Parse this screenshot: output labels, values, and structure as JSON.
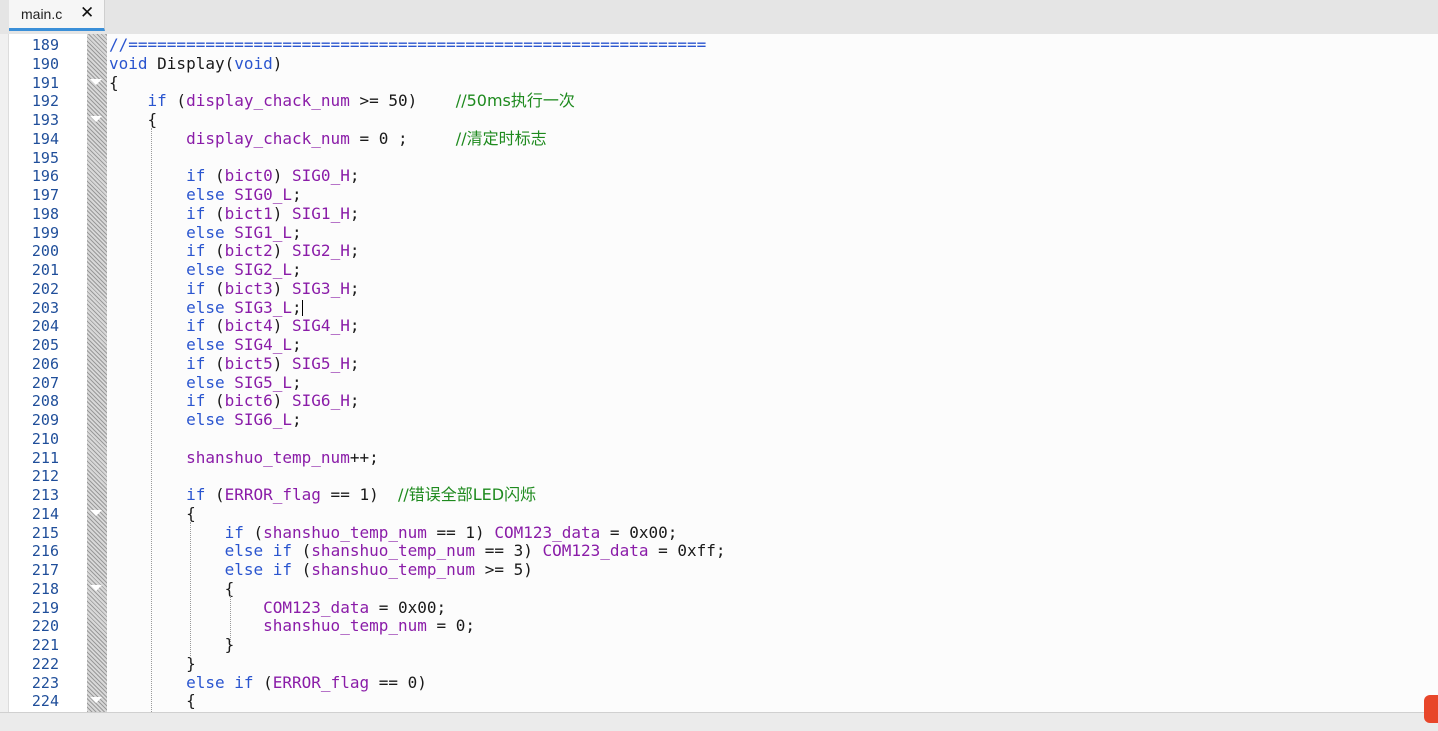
{
  "tab": {
    "filename": "main.c",
    "close_glyph": "✕"
  },
  "editor": {
    "lines": [
      {
        "n": "189",
        "segs": [
          {
            "t": "//============================================================",
            "c": "kw"
          }
        ]
      },
      {
        "n": "190",
        "segs": [
          {
            "t": "void",
            "c": "kw"
          },
          {
            "t": " Display(",
            "c": ""
          },
          {
            "t": "void",
            "c": "kw"
          },
          {
            "t": ")",
            "c": ""
          }
        ]
      },
      {
        "n": "191",
        "fold": true,
        "segs": [
          {
            "t": "{",
            "c": ""
          }
        ]
      },
      {
        "n": "192",
        "segs": [
          {
            "t": "    ",
            "c": ""
          },
          {
            "t": "if",
            "c": "kw"
          },
          {
            "t": " (",
            "c": ""
          },
          {
            "t": "display_chack_num",
            "c": "mac"
          },
          {
            "t": " >= 50)    ",
            "c": ""
          },
          {
            "t": "//50ms执行一次",
            "c": "com"
          }
        ]
      },
      {
        "n": "193",
        "fold": true,
        "segs": [
          {
            "t": "    {",
            "c": ""
          }
        ]
      },
      {
        "n": "194",
        "segs": [
          {
            "t": "        ",
            "c": ""
          },
          {
            "t": "display_chack_num",
            "c": "mac"
          },
          {
            "t": " = 0 ;     ",
            "c": ""
          },
          {
            "t": "//清定时标志",
            "c": "com"
          }
        ]
      },
      {
        "n": "195",
        "segs": []
      },
      {
        "n": "196",
        "segs": [
          {
            "t": "        ",
            "c": ""
          },
          {
            "t": "if",
            "c": "kw"
          },
          {
            "t": " (",
            "c": ""
          },
          {
            "t": "bict0",
            "c": "mac"
          },
          {
            "t": ") ",
            "c": ""
          },
          {
            "t": "SIG0_H",
            "c": "mac"
          },
          {
            "t": ";",
            "c": ""
          }
        ]
      },
      {
        "n": "197",
        "segs": [
          {
            "t": "        ",
            "c": ""
          },
          {
            "t": "else",
            "c": "kw"
          },
          {
            "t": " ",
            "c": ""
          },
          {
            "t": "SIG0_L",
            "c": "mac"
          },
          {
            "t": ";",
            "c": ""
          }
        ]
      },
      {
        "n": "198",
        "segs": [
          {
            "t": "        ",
            "c": ""
          },
          {
            "t": "if",
            "c": "kw"
          },
          {
            "t": " (",
            "c": ""
          },
          {
            "t": "bict1",
            "c": "mac"
          },
          {
            "t": ") ",
            "c": ""
          },
          {
            "t": "SIG1_H",
            "c": "mac"
          },
          {
            "t": ";",
            "c": ""
          }
        ]
      },
      {
        "n": "199",
        "segs": [
          {
            "t": "        ",
            "c": ""
          },
          {
            "t": "else",
            "c": "kw"
          },
          {
            "t": " ",
            "c": ""
          },
          {
            "t": "SIG1_L",
            "c": "mac"
          },
          {
            "t": ";",
            "c": ""
          }
        ]
      },
      {
        "n": "200",
        "segs": [
          {
            "t": "        ",
            "c": ""
          },
          {
            "t": "if",
            "c": "kw"
          },
          {
            "t": " (",
            "c": ""
          },
          {
            "t": "bict2",
            "c": "mac"
          },
          {
            "t": ") ",
            "c": ""
          },
          {
            "t": "SIG2_H",
            "c": "mac"
          },
          {
            "t": ";",
            "c": ""
          }
        ]
      },
      {
        "n": "201",
        "segs": [
          {
            "t": "        ",
            "c": ""
          },
          {
            "t": "else",
            "c": "kw"
          },
          {
            "t": " ",
            "c": ""
          },
          {
            "t": "SIG2_L",
            "c": "mac"
          },
          {
            "t": ";",
            "c": ""
          }
        ]
      },
      {
        "n": "202",
        "segs": [
          {
            "t": "        ",
            "c": ""
          },
          {
            "t": "if",
            "c": "kw"
          },
          {
            "t": " (",
            "c": ""
          },
          {
            "t": "bict3",
            "c": "mac"
          },
          {
            "t": ") ",
            "c": ""
          },
          {
            "t": "SIG3_H",
            "c": "mac"
          },
          {
            "t": ";",
            "c": ""
          }
        ]
      },
      {
        "n": "203",
        "caret": true,
        "segs": [
          {
            "t": "        ",
            "c": ""
          },
          {
            "t": "else",
            "c": "kw"
          },
          {
            "t": " ",
            "c": ""
          },
          {
            "t": "SIG3_L",
            "c": "mac"
          },
          {
            "t": ";",
            "c": ""
          }
        ]
      },
      {
        "n": "204",
        "segs": [
          {
            "t": "        ",
            "c": ""
          },
          {
            "t": "if",
            "c": "kw"
          },
          {
            "t": " (",
            "c": ""
          },
          {
            "t": "bict4",
            "c": "mac"
          },
          {
            "t": ") ",
            "c": ""
          },
          {
            "t": "SIG4_H",
            "c": "mac"
          },
          {
            "t": ";",
            "c": ""
          }
        ]
      },
      {
        "n": "205",
        "segs": [
          {
            "t": "        ",
            "c": ""
          },
          {
            "t": "else",
            "c": "kw"
          },
          {
            "t": " ",
            "c": ""
          },
          {
            "t": "SIG4_L",
            "c": "mac"
          },
          {
            "t": ";",
            "c": ""
          }
        ]
      },
      {
        "n": "206",
        "segs": [
          {
            "t": "        ",
            "c": ""
          },
          {
            "t": "if",
            "c": "kw"
          },
          {
            "t": " (",
            "c": ""
          },
          {
            "t": "bict5",
            "c": "mac"
          },
          {
            "t": ") ",
            "c": ""
          },
          {
            "t": "SIG5_H",
            "c": "mac"
          },
          {
            "t": ";",
            "c": ""
          }
        ]
      },
      {
        "n": "207",
        "segs": [
          {
            "t": "        ",
            "c": ""
          },
          {
            "t": "else",
            "c": "kw"
          },
          {
            "t": " ",
            "c": ""
          },
          {
            "t": "SIG5_L",
            "c": "mac"
          },
          {
            "t": ";",
            "c": ""
          }
        ]
      },
      {
        "n": "208",
        "segs": [
          {
            "t": "        ",
            "c": ""
          },
          {
            "t": "if",
            "c": "kw"
          },
          {
            "t": " (",
            "c": ""
          },
          {
            "t": "bict6",
            "c": "mac"
          },
          {
            "t": ") ",
            "c": ""
          },
          {
            "t": "SIG6_H",
            "c": "mac"
          },
          {
            "t": ";",
            "c": ""
          }
        ]
      },
      {
        "n": "209",
        "segs": [
          {
            "t": "        ",
            "c": ""
          },
          {
            "t": "else",
            "c": "kw"
          },
          {
            "t": " ",
            "c": ""
          },
          {
            "t": "SIG6_L",
            "c": "mac"
          },
          {
            "t": ";",
            "c": ""
          }
        ]
      },
      {
        "n": "210",
        "segs": []
      },
      {
        "n": "211",
        "segs": [
          {
            "t": "        ",
            "c": ""
          },
          {
            "t": "shanshuo_temp_num",
            "c": "mac"
          },
          {
            "t": "++;",
            "c": ""
          }
        ]
      },
      {
        "n": "212",
        "segs": []
      },
      {
        "n": "213",
        "segs": [
          {
            "t": "        ",
            "c": ""
          },
          {
            "t": "if",
            "c": "kw"
          },
          {
            "t": " (",
            "c": ""
          },
          {
            "t": "ERROR_flag",
            "c": "mac"
          },
          {
            "t": " == 1)  ",
            "c": ""
          },
          {
            "t": "//错误全部LED闪烁",
            "c": "com"
          }
        ]
      },
      {
        "n": "214",
        "fold": true,
        "segs": [
          {
            "t": "        {",
            "c": ""
          }
        ]
      },
      {
        "n": "215",
        "segs": [
          {
            "t": "            ",
            "c": ""
          },
          {
            "t": "if",
            "c": "kw"
          },
          {
            "t": " (",
            "c": ""
          },
          {
            "t": "shanshuo_temp_num",
            "c": "mac"
          },
          {
            "t": " == 1) ",
            "c": ""
          },
          {
            "t": "COM123_data",
            "c": "mac"
          },
          {
            "t": " = 0x00;",
            "c": ""
          }
        ]
      },
      {
        "n": "216",
        "segs": [
          {
            "t": "            ",
            "c": ""
          },
          {
            "t": "else if",
            "c": "kw"
          },
          {
            "t": " (",
            "c": ""
          },
          {
            "t": "shanshuo_temp_num",
            "c": "mac"
          },
          {
            "t": " == 3) ",
            "c": ""
          },
          {
            "t": "COM123_data",
            "c": "mac"
          },
          {
            "t": " = 0xff;",
            "c": ""
          }
        ]
      },
      {
        "n": "217",
        "segs": [
          {
            "t": "            ",
            "c": ""
          },
          {
            "t": "else if",
            "c": "kw"
          },
          {
            "t": " (",
            "c": ""
          },
          {
            "t": "shanshuo_temp_num",
            "c": "mac"
          },
          {
            "t": " >= 5)",
            "c": ""
          }
        ]
      },
      {
        "n": "218",
        "fold": true,
        "segs": [
          {
            "t": "            {",
            "c": ""
          }
        ]
      },
      {
        "n": "219",
        "segs": [
          {
            "t": "                ",
            "c": ""
          },
          {
            "t": "COM123_data",
            "c": "mac"
          },
          {
            "t": " = 0x00;",
            "c": ""
          }
        ]
      },
      {
        "n": "220",
        "segs": [
          {
            "t": "                ",
            "c": ""
          },
          {
            "t": "shanshuo_temp_num",
            "c": "mac"
          },
          {
            "t": " = 0;",
            "c": ""
          }
        ]
      },
      {
        "n": "221",
        "segs": [
          {
            "t": "            }",
            "c": ""
          }
        ]
      },
      {
        "n": "222",
        "segs": [
          {
            "t": "        }",
            "c": ""
          }
        ]
      },
      {
        "n": "223",
        "segs": [
          {
            "t": "        ",
            "c": ""
          },
          {
            "t": "else if",
            "c": "kw"
          },
          {
            "t": " (",
            "c": ""
          },
          {
            "t": "ERROR_flag",
            "c": "mac"
          },
          {
            "t": " == 0)",
            "c": ""
          }
        ]
      },
      {
        "n": "224",
        "fold": true,
        "segs": [
          {
            "t": "        {",
            "c": ""
          }
        ]
      }
    ]
  },
  "colors": {
    "keyword": "#2a55cf",
    "identifier": "#8a1ca8",
    "comment": "#1e8a1e",
    "line_number": "#1f4e9a",
    "tab_accent": "#3a8fd8"
  }
}
